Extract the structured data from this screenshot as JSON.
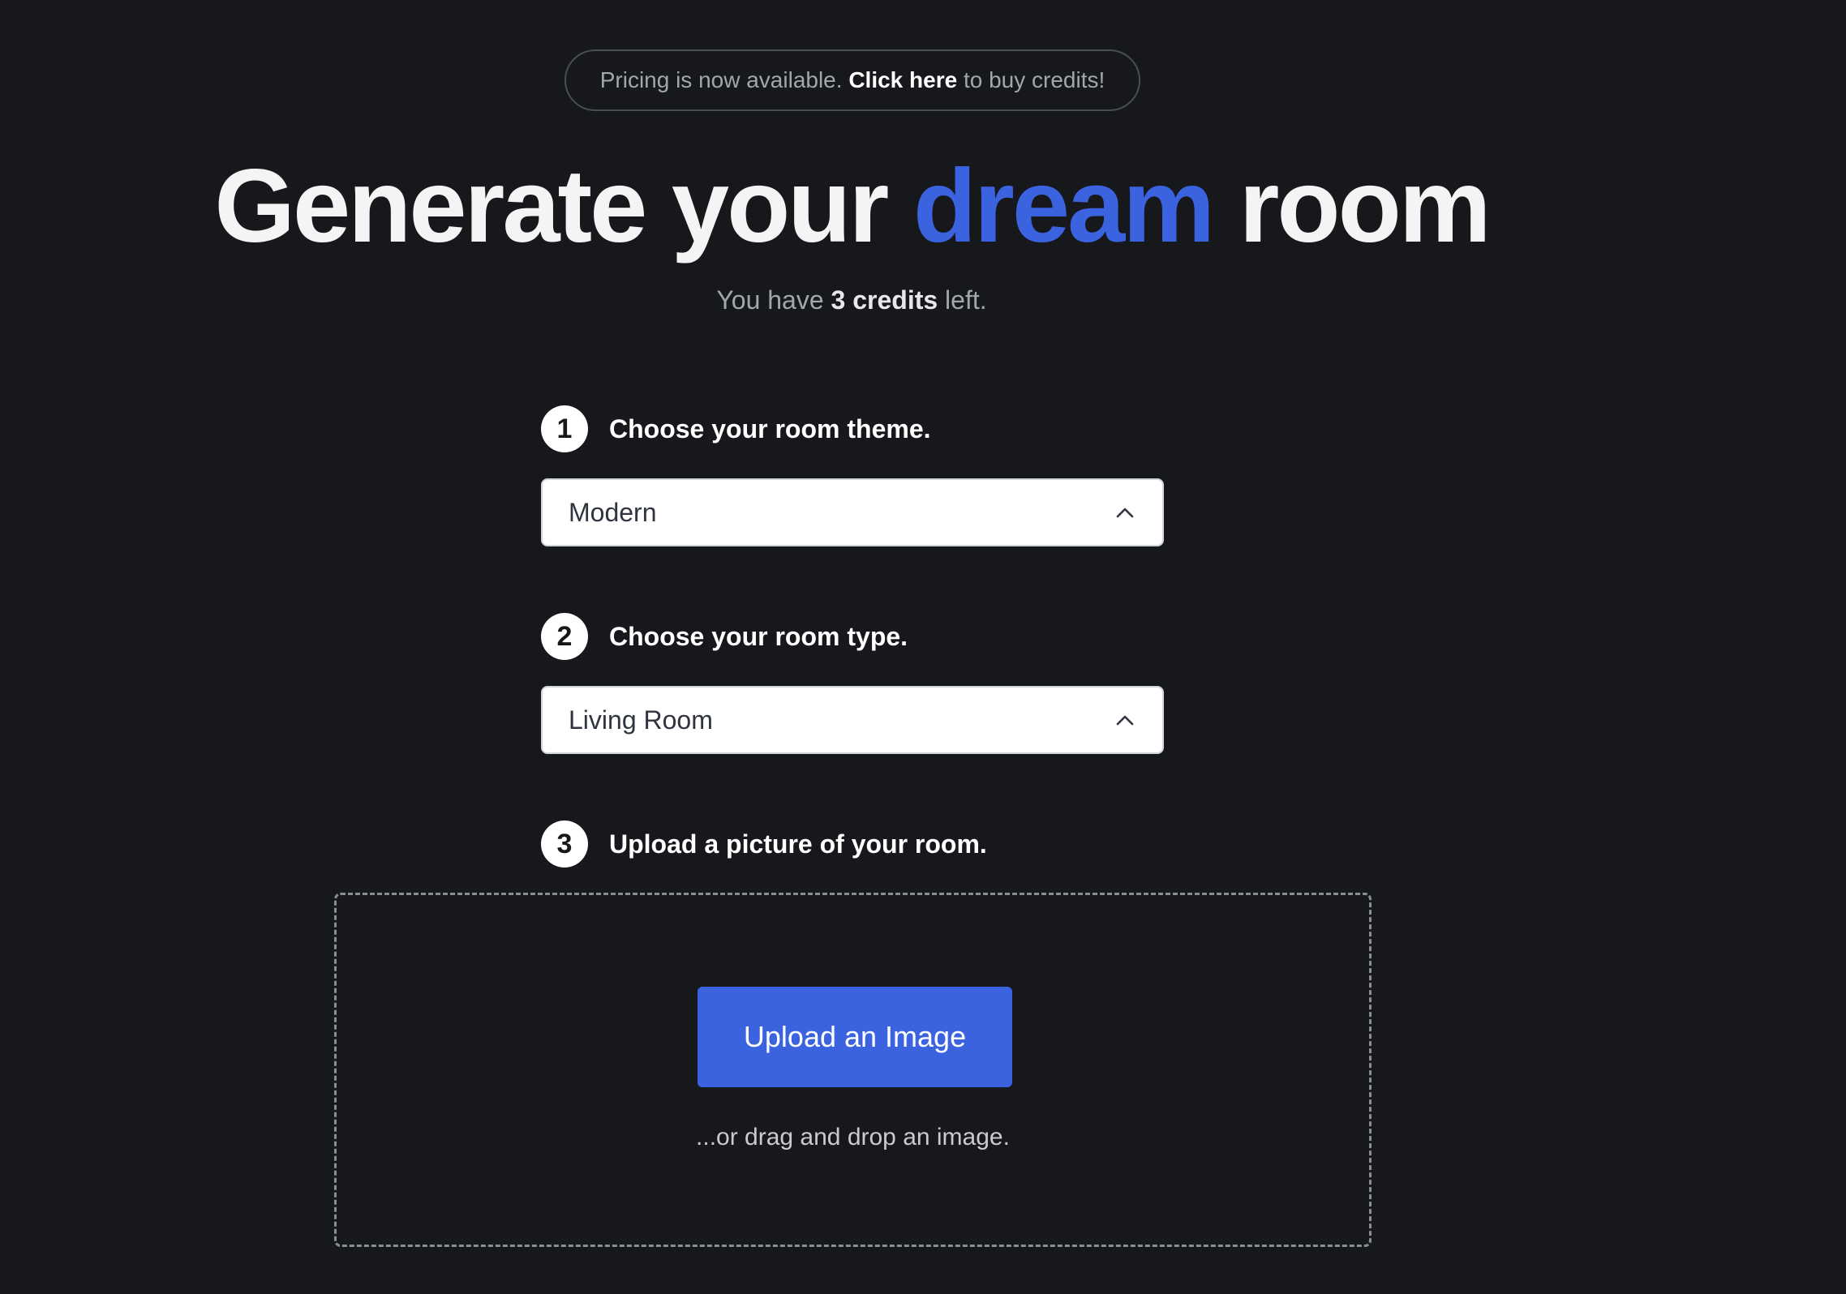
{
  "announcement": {
    "prefix": "Pricing is now available.",
    "link": "Click here",
    "suffix": "to buy credits!"
  },
  "headline": {
    "part1": "Generate your",
    "accent": "dream",
    "part2": "room",
    "accent_color": "#3b63e0"
  },
  "credits": {
    "prefix": "You have",
    "count": "3 credits",
    "suffix": "left."
  },
  "steps": [
    {
      "number": "1",
      "label": "Choose your room theme."
    },
    {
      "number": "2",
      "label": "Choose your room type."
    },
    {
      "number": "3",
      "label": "Upload a picture of your room."
    }
  ],
  "theme_select": {
    "value": "Modern",
    "icon": "chevron-up-icon"
  },
  "type_select": {
    "value": "Living Room",
    "icon": "chevron-up-icon"
  },
  "upload": {
    "button_label": "Upload an Image",
    "drag_text": "...or drag and drop an image.",
    "button_color": "#3b63e0"
  }
}
